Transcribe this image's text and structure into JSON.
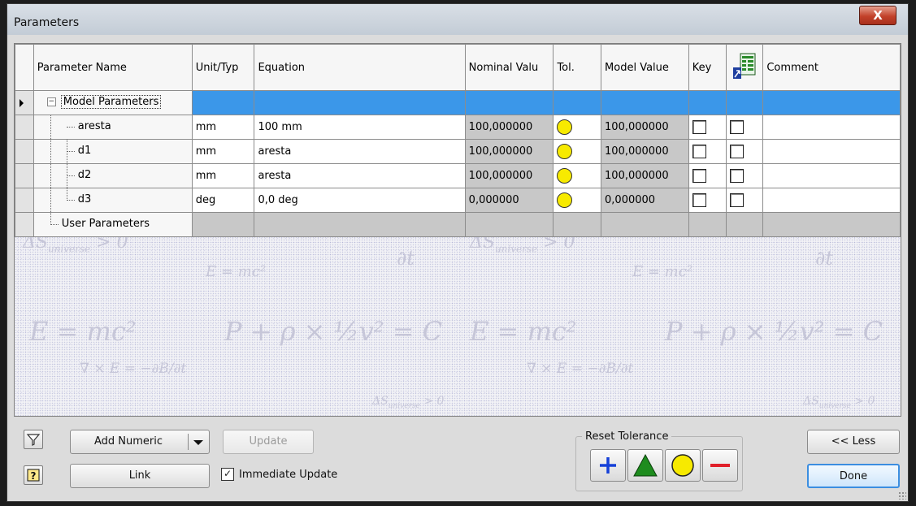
{
  "window": {
    "title": "Parameters",
    "close_label": "X"
  },
  "table": {
    "headers": {
      "name": "Parameter Name",
      "unit": "Unit/Typ",
      "equation": "Equation",
      "nominal": "Nominal Valu",
      "tol": "Tol.",
      "model": "Model Value",
      "key": "Key",
      "export_icon": "export-parameter-icon",
      "comment": "Comment"
    },
    "group_model": "Model Parameters",
    "group_user": "User Parameters",
    "rows": [
      {
        "name": "aresta",
        "unit": "mm",
        "equation": "100 mm",
        "nominal": "100,000000",
        "model": "100,000000"
      },
      {
        "name": "d1",
        "unit": "mm",
        "equation": "aresta",
        "nominal": "100,000000",
        "model": "100,000000"
      },
      {
        "name": "d2",
        "unit": "mm",
        "equation": "aresta",
        "nominal": "100,000000",
        "model": "100,000000"
      },
      {
        "name": "d3",
        "unit": "deg",
        "equation": "0,0 deg",
        "nominal": "0,000000",
        "model": "0,000000"
      }
    ]
  },
  "buttons": {
    "add_numeric": "Add Numeric",
    "update": "Update",
    "link": "Link",
    "less": "<< Less",
    "done": "Done"
  },
  "immediate_update": {
    "label": "Immediate Update",
    "checked": true
  },
  "reset_tolerance": {
    "label": "Reset Tolerance"
  },
  "colors": {
    "selection": "#3b97e9",
    "tol_circle": "#f7ea00",
    "green": "#1e8c1e",
    "red": "#e0202a",
    "blue": "#1540d8"
  }
}
